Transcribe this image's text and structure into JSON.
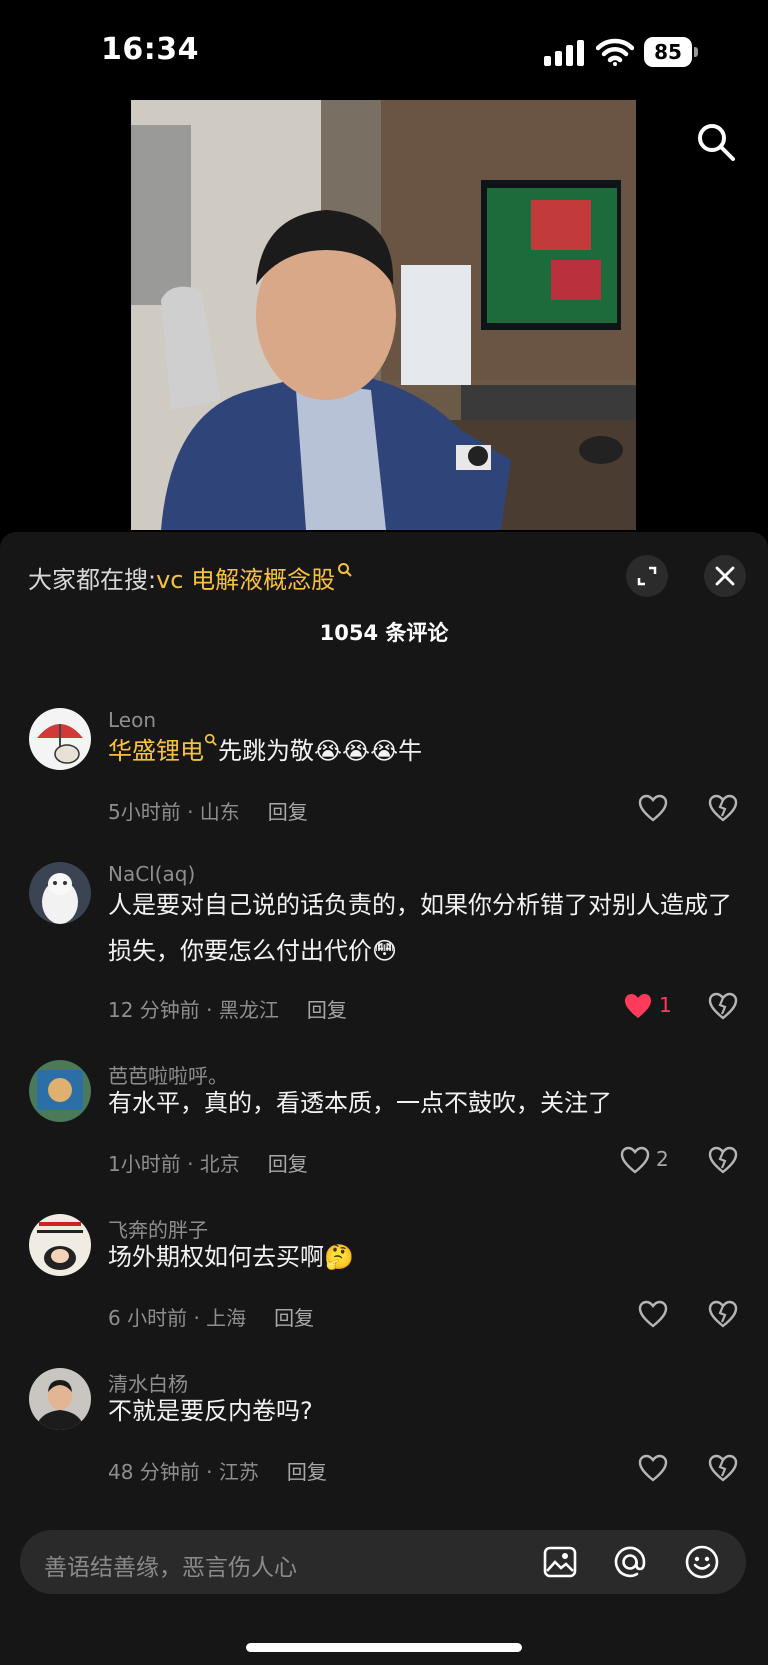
{
  "status": {
    "time": "16:34",
    "battery": "85"
  },
  "search_hint": {
    "prefix": "大家都在搜:",
    "keyword": "vc 电解液概念股"
  },
  "comments_header": {
    "count_label": "1054 条评论"
  },
  "comments": [
    {
      "user": "Leon",
      "text_keyword": "华盛锂电",
      "text": "先跳为敬😭😭😭牛",
      "time": "5小时前 · 山东",
      "reply": "回复",
      "likes": ""
    },
    {
      "user": "NaCl(aq)",
      "text": "人是要对自己说的话负责的，如果你分析错了对别人造成了损失，你要怎么付出代价😳",
      "time": "12 分钟前 · 黑龙江",
      "reply": "回复",
      "likes": "1"
    },
    {
      "user": "芭芭啦啦呼。",
      "text": "有水平，真的，看透本质，一点不鼓吹，关注了",
      "time": "1小时前 · 北京",
      "reply": "回复",
      "likes": "2"
    },
    {
      "user": "飞奔的胖子",
      "text": "场外期权如何去买啊🤔",
      "time": "6 小时前 · 上海",
      "reply": "回复",
      "likes": ""
    },
    {
      "user": "清水白杨",
      "text": "不就是要反内卷吗?",
      "time": "48 分钟前 · 江苏",
      "reply": "回复",
      "likes": ""
    }
  ],
  "input": {
    "placeholder": "善语结善缘，恶言伤人心"
  },
  "icons": [
    "signal-icon",
    "wifi-icon",
    "battery-icon",
    "search-icon",
    "expand-icon",
    "close-icon",
    "heart-icon",
    "broken-heart-icon",
    "image-icon",
    "at-icon",
    "emoji-icon"
  ],
  "colors": {
    "keyword": "#f6c23e",
    "liked_heart": "#ff3b5c",
    "sheet_bg": "#161616"
  }
}
